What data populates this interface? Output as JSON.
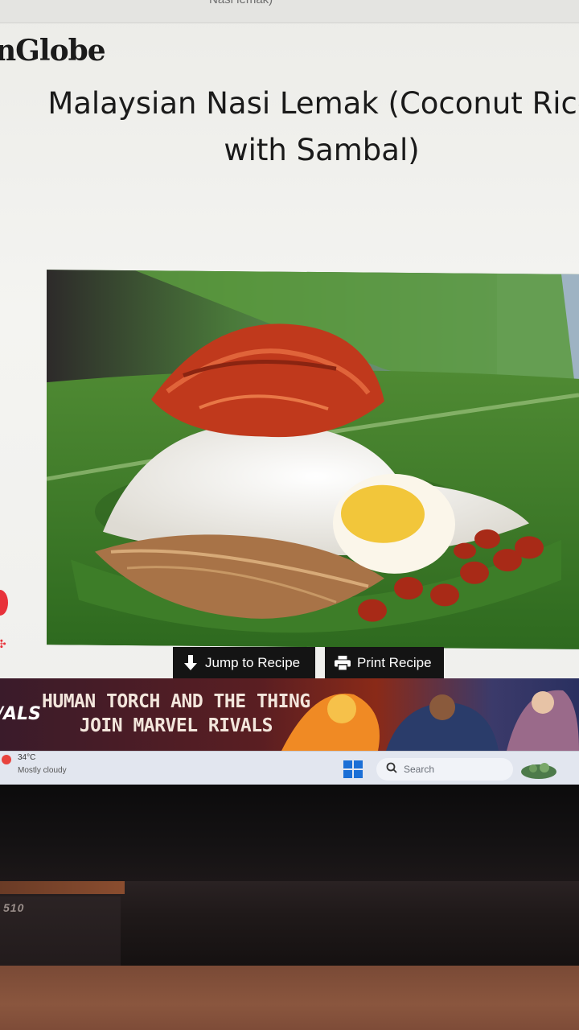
{
  "browser": {
    "url_fragment": "Nasi lemak)"
  },
  "site": {
    "logo_partial": "nGlobe"
  },
  "article": {
    "title_line1": "Malaysian Nasi Lemak (Coconut Rice",
    "title_line2": "with Sambal)"
  },
  "buttons": {
    "jump_to_recipe": "Jump to Recipe",
    "print_recipe": "Print Recipe"
  },
  "ad": {
    "logo_partial": "/ALS",
    "headline_line1": "HUMAN TORCH AND THE THING",
    "headline_line2": "JOIN MARVEL RIVALS"
  },
  "taskbar": {
    "temperature": "34°C",
    "weather": "Mostly cloudy",
    "search_label": "Search"
  },
  "laptop": {
    "model_partial": "510"
  },
  "colors": {
    "button_bg": "#141414",
    "windows_blue": "#1b6fd6",
    "banana_leaf": "#3a6b2a"
  }
}
